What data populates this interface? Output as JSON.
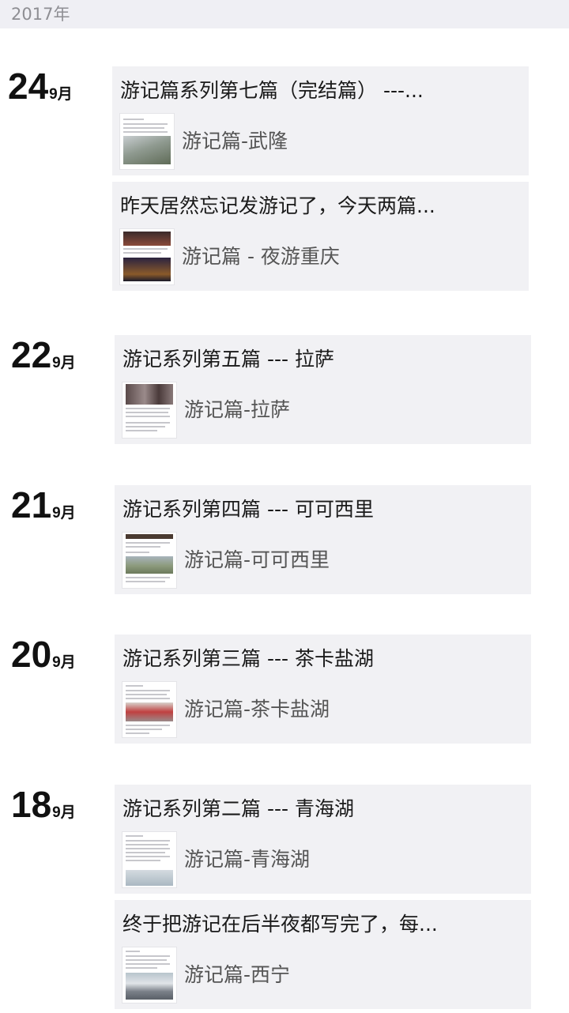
{
  "year": "2017年",
  "groups": [
    {
      "day": "24",
      "month": "9月",
      "posts": [
        {
          "title": "游记篇系列第七篇（完结篇） ---...",
          "article": "游记篇-武隆"
        },
        {
          "title": "昨天居然忘记发游记了，今天两篇...",
          "article": "游记篇 - 夜游重庆"
        }
      ]
    },
    {
      "day": "22",
      "month": "9月",
      "posts": [
        {
          "title": "游记系列第五篇 --- 拉萨",
          "article": "游记篇-拉萨"
        }
      ]
    },
    {
      "day": "21",
      "month": "9月",
      "posts": [
        {
          "title": "游记系列第四篇 --- 可可西里",
          "article": "游记篇-可可西里"
        }
      ]
    },
    {
      "day": "20",
      "month": "9月",
      "posts": [
        {
          "title": "游记系列第三篇 --- 茶卡盐湖",
          "article": "游记篇-茶卡盐湖"
        }
      ]
    },
    {
      "day": "18",
      "month": "9月",
      "posts": [
        {
          "title": "游记系列第二篇  ---  青海湖",
          "article": "游记篇-青海湖"
        },
        {
          "title": "终于把游记在后半夜都写完了，每...",
          "article": "游记篇-西宁"
        }
      ]
    }
  ]
}
